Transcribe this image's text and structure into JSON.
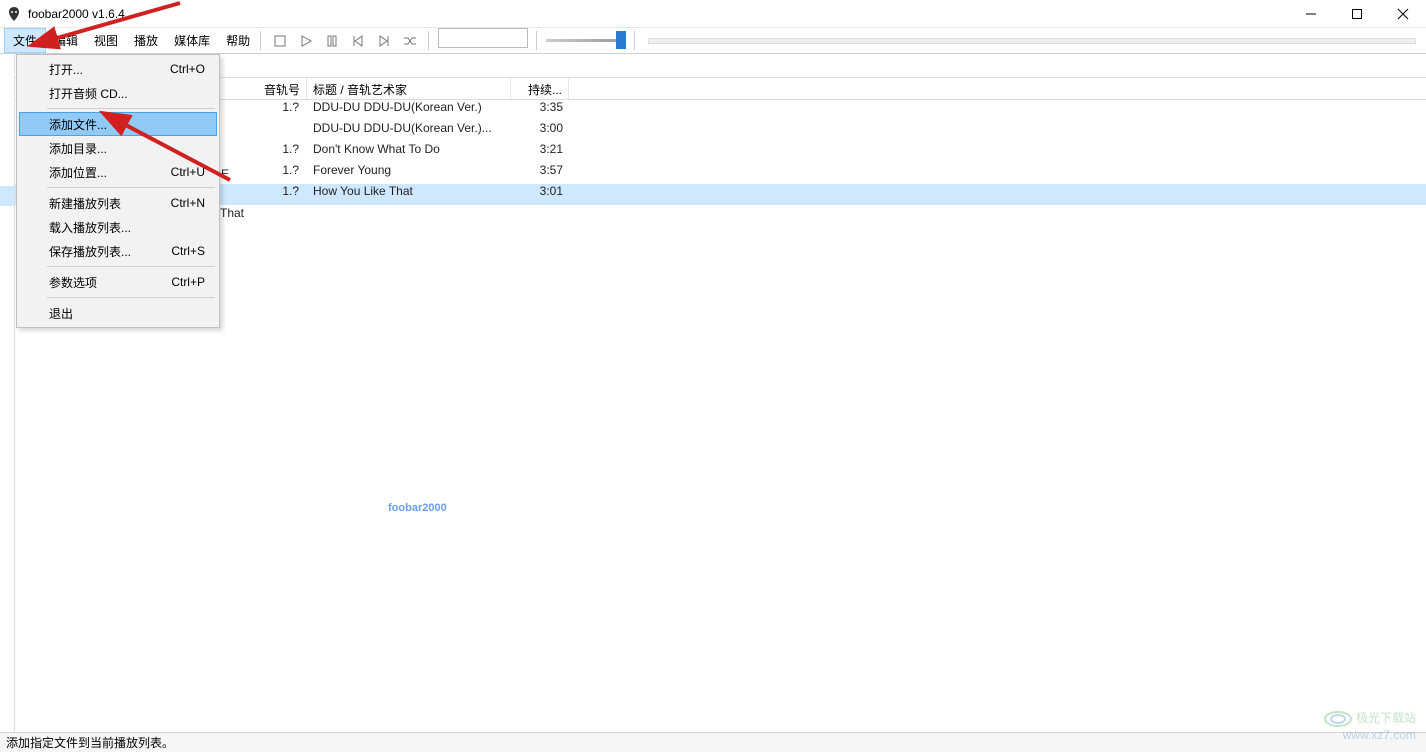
{
  "window": {
    "title": "foobar2000 v1.6.4"
  },
  "menus": {
    "file": "文件",
    "edit": "编辑",
    "view": "视图",
    "play": "播放",
    "library": "媒体库",
    "help": "帮助"
  },
  "file_menu": {
    "open": {
      "label": "打开...",
      "shortcut": "Ctrl+O"
    },
    "open_audio_cd": {
      "label": "打开音频 CD..."
    },
    "add_files": {
      "label": "添加文件..."
    },
    "add_folder": {
      "label": "添加目录..."
    },
    "add_location": {
      "label": "添加位置...",
      "shortcut": "Ctrl+U"
    },
    "new_playlist": {
      "label": "新建播放列表",
      "shortcut": "Ctrl+N"
    },
    "load_playlist": {
      "label": "载入播放列表..."
    },
    "save_playlist": {
      "label": "保存播放列表...",
      "shortcut": "Ctrl+S"
    },
    "preferences": {
      "label": "参数选项",
      "shortcut": "Ctrl+P"
    },
    "exit": {
      "label": "退出"
    }
  },
  "playlist": {
    "columns": {
      "track_no": "音轨号",
      "title_artist": "标题 / 音轨艺术家",
      "duration": "持续..."
    },
    "rows": [
      {
        "idx": "1.?",
        "title": "DDU-DU DDU-DU(Korean Ver.)",
        "dur": "3:35"
      },
      {
        "idx": "",
        "title": "DDU-DU DDU-DU(Korean Ver.)...",
        "dur": "3:00"
      },
      {
        "idx": "1.?",
        "title": "Don't Know What To Do",
        "dur": "3:21"
      },
      {
        "idx": "1.?",
        "title": "Forever Young",
        "dur": "3:57"
      },
      {
        "idx": "1.?",
        "title": "How You Like That",
        "dur": "3:01"
      }
    ],
    "peek_text": "That",
    "peek_tab": "E"
  },
  "status": "添加指定文件到当前播放列表。",
  "center_watermark": "foobar2000",
  "corner_watermark": {
    "line1": "极光下载站",
    "line2": "www.xz7.com"
  }
}
